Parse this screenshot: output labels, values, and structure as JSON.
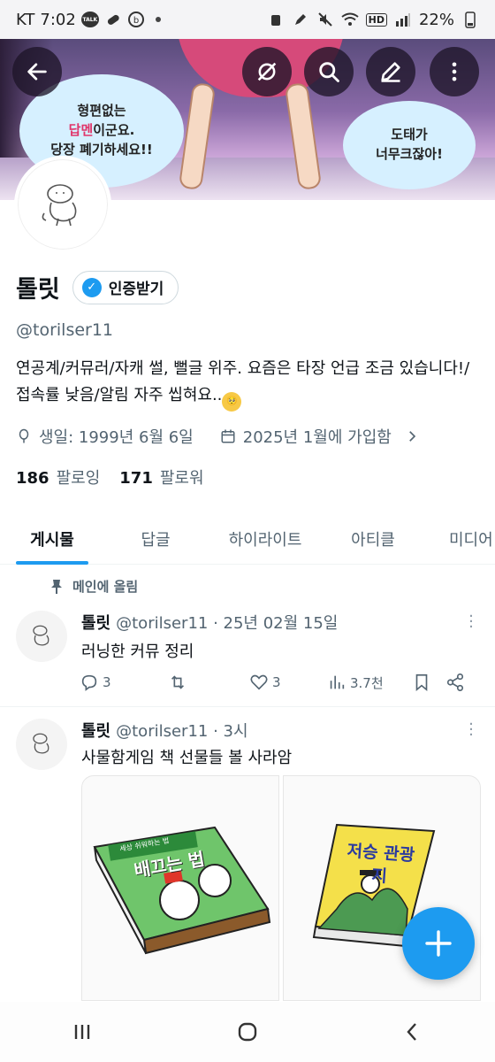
{
  "status_bar": {
    "carrier": "KT",
    "time": "7:02",
    "talk_badge": "TALK",
    "battery": "22%",
    "network": "HD"
  },
  "banner": {
    "bubble_left": [
      "형편없는",
      "답멘이군요.",
      "당장 폐기하세요!!"
    ],
    "bubble_left_highlight": "답멘",
    "bubble_right": [
      "도태가",
      "너무크잖아!"
    ]
  },
  "profile": {
    "display_name": "톨릿",
    "verify_label": "인증받기",
    "handle": "@torilser11",
    "bio": "연공계/커뮤러/자캐 썰, 뻘글 위주. 요즘은 타장 언급 조금 있습니다!/접속률 낮음/알림 자주 씹혀요..",
    "birthday": "생일: 1999년 6월 6일",
    "joined": "2025년 1월에 가입함",
    "following_count": "186",
    "following_label": "팔로잉",
    "followers_count": "171",
    "followers_label": "팔로워"
  },
  "tabs": [
    {
      "label": "게시물",
      "active": true
    },
    {
      "label": "답글",
      "active": false
    },
    {
      "label": "하이라이트",
      "active": false
    },
    {
      "label": "아티클",
      "active": false
    },
    {
      "label": "미디어",
      "active": false
    }
  ],
  "pinned_label": "메인에 올림",
  "tweets": [
    {
      "name": "톨릿",
      "meta": "@torilser11 · 25년 02월 15일",
      "text": "러닝한 커뮤 정리",
      "replies": "3",
      "retweets": "",
      "likes": "3",
      "views": "3.7천"
    },
    {
      "name": "톨릿",
      "meta": "@torilser11 · 3시",
      "text": "사물함게임 책 선물들 볼 사라암",
      "images": [
        {
          "title": "배끄는 법",
          "subtitle": "세상 쉬워하는 법"
        },
        {
          "title": "저승 관광지",
          "subtitle": ""
        }
      ]
    }
  ],
  "colors": {
    "accent": "#1d9bf0",
    "secondary_text": "#536471",
    "primary_text": "#0f1419"
  }
}
